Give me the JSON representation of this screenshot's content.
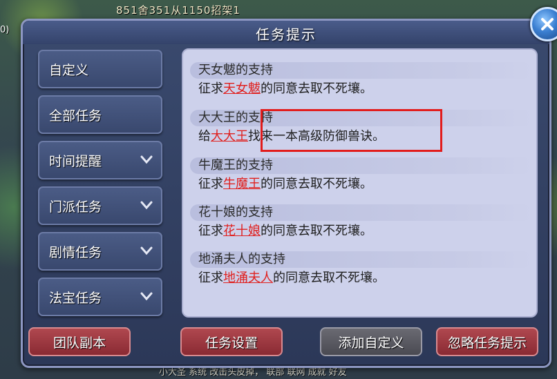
{
  "scene": {
    "top_text": "851舍351从1150招架1",
    "left_text": "0)",
    "bottom_text": "小大圣   系统   改击头皮掉，   联部   联网   成就   好友"
  },
  "dialog": {
    "title": "任务提示",
    "close_label": "close"
  },
  "tabs": [
    {
      "label": "自定义",
      "has_chevron": false
    },
    {
      "label": "全部任务",
      "has_chevron": false
    },
    {
      "label": "时间提醒",
      "has_chevron": true
    },
    {
      "label": "门派任务",
      "has_chevron": true
    },
    {
      "label": "剧情任务",
      "has_chevron": true
    },
    {
      "label": "法宝任务",
      "has_chevron": true
    }
  ],
  "entries": [
    {
      "title": "天女魃的支持",
      "desc_prefix": "征求",
      "npc": "天女魃",
      "desc_suffix": "的同意去取不死壤。"
    },
    {
      "title": "大大王的支持",
      "desc_prefix": "给",
      "npc": "大大王",
      "desc_suffix": "找来一本高级防御兽诀。"
    },
    {
      "title": "牛魔王的支持",
      "desc_prefix": "征求",
      "npc": "牛魔王",
      "desc_suffix": "的同意去取不死壤。"
    },
    {
      "title": "花十娘的支持",
      "desc_prefix": "征求",
      "npc": "花十娘",
      "desc_suffix": "的同意去取不死壤。"
    },
    {
      "title": "地涌夫人的支持",
      "desc_prefix": "征求",
      "npc": "地涌夫人",
      "desc_suffix": "的同意去取不死壤。"
    }
  ],
  "buttons": {
    "team_dungeon": "团队副本",
    "task_settings": "任务设置",
    "add_custom": "添加自定义",
    "ignore_prompt": "忽略任务提示"
  },
  "colors": {
    "npc_name": "#e0201e",
    "highlight_box": "#e21c1c",
    "panel_bg": "#cdd1eb"
  }
}
